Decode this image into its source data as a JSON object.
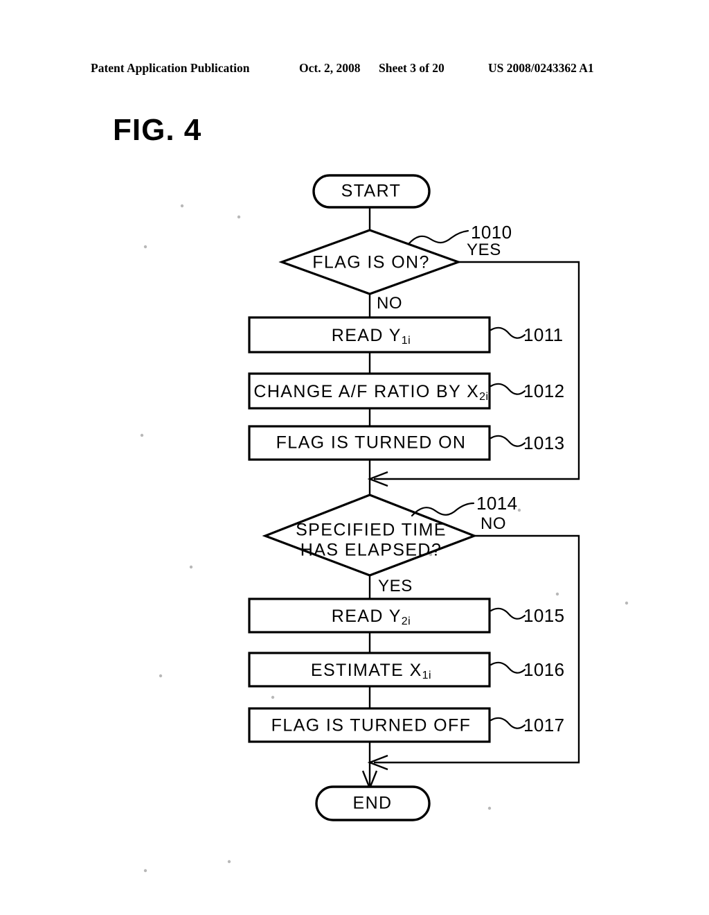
{
  "header": {
    "publication": "Patent Application Publication",
    "date": "Oct. 2, 2008",
    "sheet": "Sheet 3 of 20",
    "doc_number": "US 2008/0243362 A1"
  },
  "figure": {
    "label": "FIG. 4"
  },
  "flowchart": {
    "start": {
      "label": "START"
    },
    "end": {
      "label": "END"
    },
    "decision_1010": {
      "ref": "1010",
      "label": "FLAG IS ON?",
      "yes_label": "YES",
      "no_label": "NO"
    },
    "step_1011": {
      "ref": "1011",
      "label": "READ Y",
      "sub": "1i"
    },
    "step_1012": {
      "ref": "1012",
      "label": "CHANGE A/F RATIO BY X",
      "sub": "2i"
    },
    "step_1013": {
      "ref": "1013",
      "label": "FLAG IS TURNED ON"
    },
    "decision_1014": {
      "ref": "1014",
      "label_line1": "SPECIFIED TIME",
      "label_line2": "HAS ELAPSED?",
      "yes_label": "YES",
      "no_label": "NO"
    },
    "step_1015": {
      "ref": "1015",
      "label": "READ Y",
      "sub": "2i"
    },
    "step_1016": {
      "ref": "1016",
      "label": "ESTIMATE X",
      "sub": "1i"
    },
    "step_1017": {
      "ref": "1017",
      "label": "FLAG IS TURNED OFF"
    }
  },
  "colors": {
    "ink": "#000000",
    "paper": "#ffffff"
  }
}
